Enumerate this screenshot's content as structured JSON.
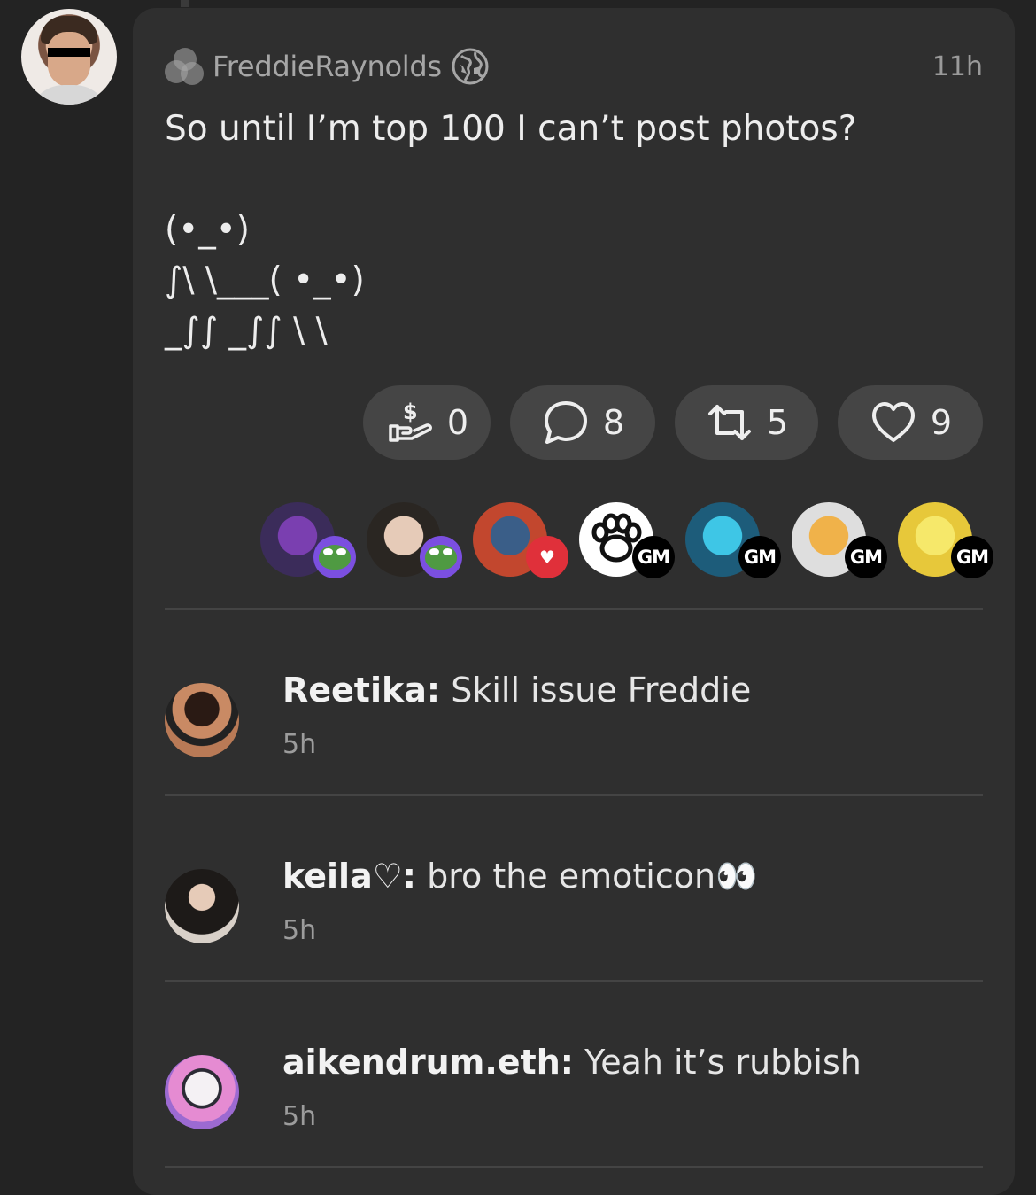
{
  "post": {
    "author": "FreddieRaynolds",
    "time": "11h",
    "text": "So until I’m top 100 I can’t post photos?\n\n(•_•)\n∫\\ \\___( •_•)\n_∫∫ _∫∫ \\ \\"
  },
  "actions": {
    "tip_count": "0",
    "reply_count": "8",
    "recast_count": "5",
    "like_count": "9"
  },
  "reactors": [
    {
      "badge": "pepe",
      "badge_label": "",
      "colors": [
        "#3b2c5a",
        "#7a3fb0"
      ]
    },
    {
      "badge": "pepe",
      "badge_label": "",
      "colors": [
        "#2a2622",
        "#e6cbb8"
      ]
    },
    {
      "badge": "heart",
      "badge_label": "♥",
      "colors": [
        "#c2472e",
        "#3a5e88"
      ]
    },
    {
      "badge": "gm",
      "badge_label": "GM",
      "colors": [
        "#ffffff",
        "#ffffff"
      ]
    },
    {
      "badge": "gm",
      "badge_label": "GM",
      "colors": [
        "#1d5c7a",
        "#3ec6e6"
      ]
    },
    {
      "badge": "gm",
      "badge_label": "GM",
      "colors": [
        "#dedede",
        "#f0b24a"
      ]
    },
    {
      "badge": "gm",
      "badge_label": "GM",
      "colors": [
        "#e7c83a",
        "#f6e86a"
      ]
    }
  ],
  "comments": [
    {
      "name": "Reetika:",
      "text": "Skill issue Freddie",
      "time": "5h"
    },
    {
      "name": "keila♡:",
      "text": "bro the emoticon👀",
      "time": "5h"
    },
    {
      "name": "aikendrum.eth:",
      "text": "Yeah it’s rubbish",
      "time": "5h"
    }
  ],
  "colors": {
    "background": "#232323",
    "card": "#2f2f2f",
    "button": "#454545"
  }
}
